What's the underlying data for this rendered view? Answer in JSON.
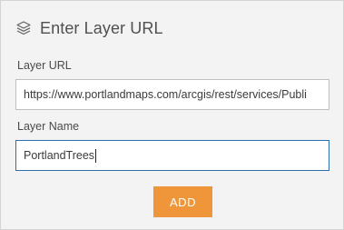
{
  "header": {
    "title": "Enter Layer URL",
    "icon": "layers-icon"
  },
  "form": {
    "url_label": "Layer URL",
    "url_value": "https://www.portlandmaps.com/arcgis/rest/services/Publi",
    "name_label": "Layer Name",
    "name_value": "PortlandTrees"
  },
  "actions": {
    "add_label": "ADD"
  },
  "colors": {
    "add_button": "#f0963a",
    "focus_border": "#2f6fae",
    "panel_bg": "#f3f3f3"
  }
}
